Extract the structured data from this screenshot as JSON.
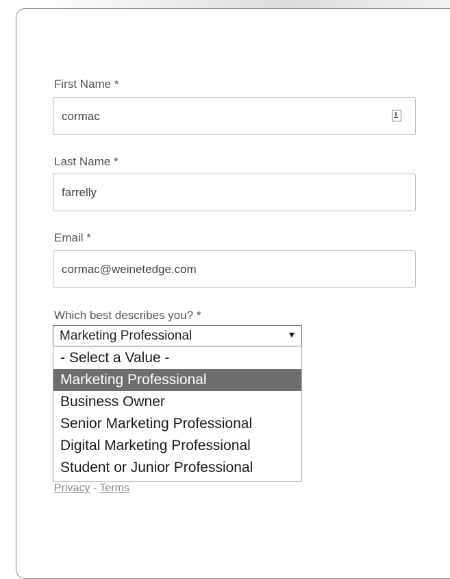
{
  "form": {
    "first_name": {
      "label": "First Name *",
      "value": "cormac"
    },
    "last_name": {
      "label": "Last Name *",
      "value": "farrelly"
    },
    "email": {
      "label": "Email *",
      "value": "cormac@weinetedge.com"
    },
    "role": {
      "label": "Which best describes you? *",
      "selected": "Marketing Professional",
      "options": [
        "- Select a Value -",
        "Marketing Professional",
        "Business Owner",
        "Senior Marketing Professional",
        "Digital Marketing Professional",
        "Student or Junior Professional"
      ],
      "highlighted_index": 1
    }
  },
  "footer": {
    "privacy": "Privacy",
    "separator": " - ",
    "terms": "Terms"
  },
  "icons": {
    "autofill": "autofill-icon",
    "dropdown_arrow": "chevron-down-icon"
  },
  "colors": {
    "highlight": "#6e6e6e",
    "border": "#b7b7b7"
  }
}
